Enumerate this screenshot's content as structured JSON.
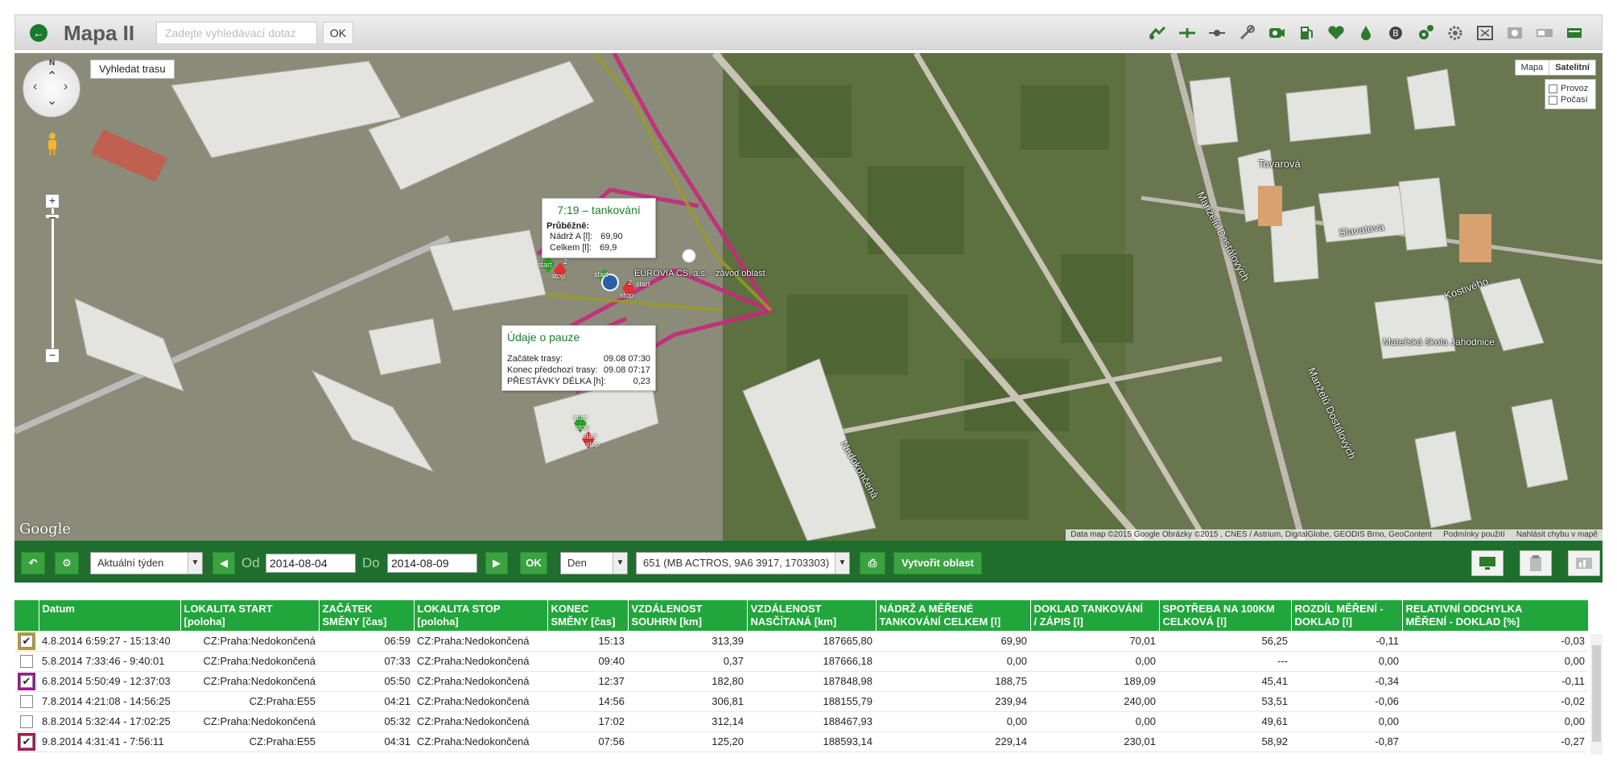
{
  "header": {
    "title": "Mapa II",
    "search_placeholder": "Zadejte vyhledávací dotaz",
    "ok_label": "OK"
  },
  "toolbar_icons": [
    "route-icon",
    "plane-icon",
    "segment-icon",
    "satellite-icon",
    "camera-icon",
    "fuel-pump-icon",
    "heart-icon",
    "drop-icon",
    "coin-icon",
    "gears-icon",
    "settings-icon",
    "expand-icon",
    "zoom-icon",
    "truck-icon",
    "card-icon"
  ],
  "map": {
    "route_button": "Vyhledat trasu",
    "map_type": [
      "Mapa",
      "Satelitní"
    ],
    "layers": [
      "Provoz",
      "Počasí"
    ],
    "streets": [
      "Tovarová",
      "Slavatova",
      "Kostivého",
      "Mateřská škola Jahodnice",
      "Nedokončená",
      "Manželů Dostálových",
      "Manželů Dostálových"
    ],
    "poi": "EUROVIA CS, a.s. - závod oblast",
    "google": "Google",
    "attribution": [
      "Data map ©2015 Google Obrázky ©2015 , CNES / Astrium, DigitalGlobe, GEODIS Brno, GeoContent",
      "Podmínky použití",
      "Nahlásit chybu v mapě"
    ],
    "popup_fuel": {
      "title": "7:19 – tankování",
      "heading": "Průběžně:",
      "rows": [
        {
          "label": "Nádrž A [l]:",
          "value": "69,90"
        },
        {
          "label": "Celkem [l]:",
          "value": "69,9"
        }
      ]
    },
    "popup_pause": {
      "title": "Údaje o pauze",
      "rows": [
        {
          "label": "Začátek trasy:",
          "value": "09.08 07:30"
        },
        {
          "label": "Konec předchozí trasy:",
          "value": "09.08 07:17"
        },
        {
          "label": "PŘESTÁVKY DÉLKA [h]:",
          "value": "0,23"
        }
      ]
    },
    "markers": [
      "start",
      "stop",
      "2",
      "start",
      "stop",
      "2",
      "start",
      "start",
      "stop",
      "start",
      "stop"
    ]
  },
  "controls": {
    "period": "Aktuální týden",
    "from_label": "Od",
    "from_value": "2014-08-04",
    "to_label": "Do",
    "to_value": "2014-08-09",
    "ok_label": "OK",
    "granularity": "Den",
    "vehicle": "651 (MB ACTROS, 9A6 3917, 1703303)",
    "create_area": "Vytvořit oblast"
  },
  "table": {
    "columns": [
      [
        "",
        ""
      ],
      [
        "Datum",
        ""
      ],
      [
        "LOKALITA START",
        "[poloha]"
      ],
      [
        "ZAČÁTEK",
        "SMĚNY [čas]"
      ],
      [
        "LOKALITA STOP",
        "[poloha]"
      ],
      [
        "KONEC",
        "SMĚNY [čas]"
      ],
      [
        "VZDÁLENOST",
        "SOUHRN [km]"
      ],
      [
        "VZDÁLENOST",
        "NASČÍTANÁ [km]"
      ],
      [
        "NÁDRŽ A MĚŘENÉ",
        "TANKOVÁNÍ CELKEM [l]"
      ],
      [
        "DOKLAD TANKOVÁNÍ",
        "/ ZÁPIS [l]"
      ],
      [
        "SPOTŘEBA NA 100KM",
        "CELKOVÁ [l]"
      ],
      [
        "ROZDÍL MĚŘENÍ -",
        "DOKLAD [l]"
      ],
      [
        "RELATIVNÍ ODCHYLKA",
        "MĚŘENÍ - DOKLAD [%]"
      ]
    ],
    "rows": [
      {
        "checked": true,
        "color": "c1",
        "cells": [
          "4.8.2014 6:59:27 - 15:13:40",
          "CZ:Praha:Nedokončená",
          "06:59",
          "CZ:Praha:Nedokončená",
          "15:13",
          "313,39",
          "187665,80",
          "69,90",
          "70,01",
          "56,25",
          "-0,11",
          "-0,03"
        ]
      },
      {
        "checked": false,
        "color": "",
        "cells": [
          "5.8.2014 7:33:46 - 9:40:01",
          "CZ:Praha:Nedokončená",
          "07:33",
          "CZ:Praha:Nedokončená",
          "09:40",
          "0,37",
          "187666,18",
          "0,00",
          "0,00",
          "---",
          "0,00",
          "0,00"
        ]
      },
      {
        "checked": true,
        "color": "c2",
        "cells": [
          "6.8.2014 5:50:49 - 12:37:03",
          "CZ:Praha:Nedokončená",
          "05:50",
          "CZ:Praha:Nedokončená",
          "12:37",
          "182,80",
          "187848,98",
          "188,75",
          "189,09",
          "45,41",
          "-0,34",
          "-0,11"
        ]
      },
      {
        "checked": false,
        "color": "",
        "cells": [
          "7.8.2014 4:21:08 - 14:56:25",
          "CZ:Praha:E55",
          "04:21",
          "CZ:Praha:Nedokončená",
          "14:56",
          "306,81",
          "188155,79",
          "239,94",
          "240,00",
          "53,51",
          "-0,06",
          "-0,02"
        ]
      },
      {
        "checked": false,
        "color": "",
        "cells": [
          "8.8.2014 5:32:44 - 17:02:25",
          "CZ:Praha:Nedokončená",
          "05:32",
          "CZ:Praha:Nedokončená",
          "17:02",
          "312,14",
          "188467,93",
          "0,00",
          "0,00",
          "49,61",
          "0,00",
          "0,00"
        ]
      },
      {
        "checked": true,
        "color": "c3",
        "cells": [
          "9.8.2014 4:31:41 - 7:56:11",
          "CZ:Praha:E55",
          "04:31",
          "CZ:Praha:Nedokončená",
          "07:56",
          "125,20",
          "188593,14",
          "229,14",
          "230,01",
          "58,92",
          "-0,87",
          "-0,27"
        ]
      }
    ]
  }
}
